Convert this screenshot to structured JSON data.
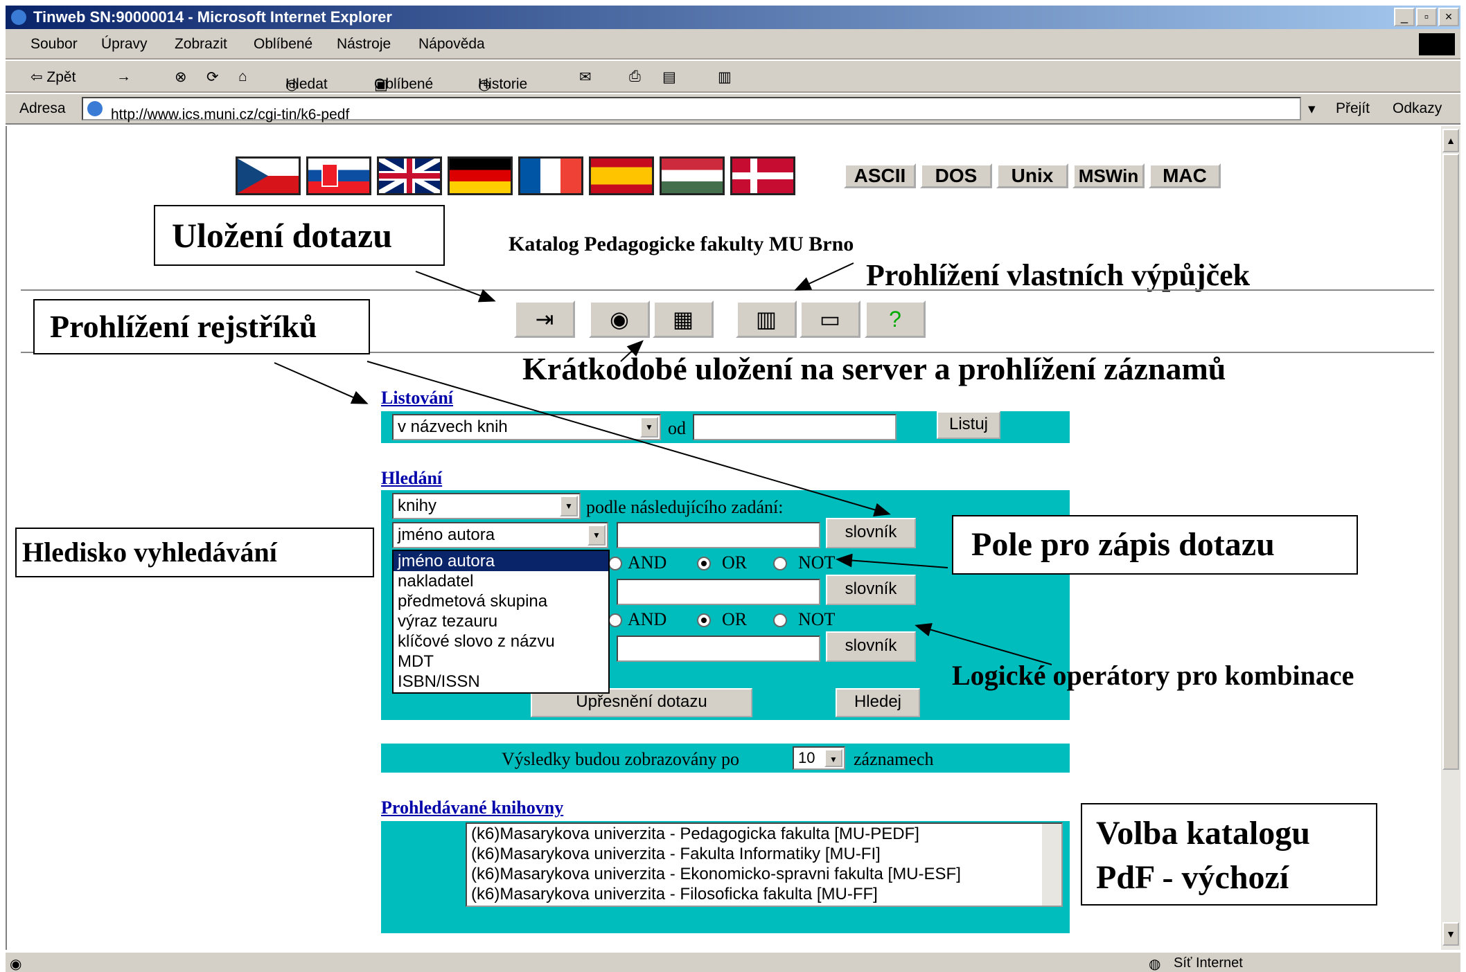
{
  "window": {
    "title": "Tinweb SN:90000014 - Microsoft Internet Explorer",
    "min": "_",
    "max": "▫",
    "close": "×"
  },
  "menu": [
    "Soubor",
    "Úpravy",
    "Zobrazit",
    "Oblíbené",
    "Nástroje",
    "Nápověda"
  ],
  "toolbar": {
    "back": "⇦ Zpět",
    "search": "Hledat",
    "favorites": "Oblíbené",
    "history": "Historie"
  },
  "address": {
    "label": "Adresa",
    "url": "http://www.ics.muni.cz/cgi-tin/k6-pedf",
    "go": "Přejít",
    "links": "Odkazy"
  },
  "encodings": [
    "ASCII",
    "DOS",
    "Unix",
    "MSWin",
    "MAC"
  ],
  "flags": [
    {
      "name": "czech",
      "colors": [
        "#ffffff",
        "#d7141a",
        "#11457e"
      ]
    },
    {
      "name": "slovak",
      "colors": [
        "#ffffff",
        "#0b4ea2",
        "#ee1c25"
      ]
    },
    {
      "name": "british",
      "colors": [
        "#012169",
        "#ffffff",
        "#c8102e"
      ]
    },
    {
      "name": "german",
      "colors": [
        "#000000",
        "#dd0000",
        "#ffce00"
      ]
    },
    {
      "name": "french",
      "colors": [
        "#0055a4",
        "#ffffff",
        "#ef4135"
      ]
    },
    {
      "name": "spanish",
      "colors": [
        "#c60b1e",
        "#ffc400",
        "#c60b1e"
      ]
    },
    {
      "name": "hungarian",
      "colors": [
        "#cd2a3e",
        "#ffffff",
        "#436f4d"
      ]
    },
    {
      "name": "danish",
      "colors": [
        "#c60c30",
        "#ffffff",
        "#c60c30"
      ]
    }
  ],
  "catalog_title": "Katalog Pedagogicke fakulty MU Brno",
  "annotations": {
    "save_query": "Uložení dotazu",
    "own_loans": "Prohlížení vlastních výpůjček",
    "browse_index": "Prohlížení rejstříků",
    "short_save": "Krátkodobé uložení na server a prohlížení záznamů",
    "search_aspect": "Hledisko vyhledávání",
    "query_field": "Pole pro zápis dotazu",
    "logic_ops": "Logické operátory pro kombinace",
    "catalog_choice_1": "Volba katalogu",
    "catalog_choice_2": "PdF - výchozí"
  },
  "help_glyph": "?",
  "listing": {
    "link": "Listování",
    "select": "v názvech knih",
    "od": "od",
    "button": "Listuj"
  },
  "search": {
    "link": "Hledání",
    "type_select": "knihy",
    "spec_label": "podle následujícího zadání:",
    "field1_select": "jméno autora",
    "dict_button": "slovník",
    "dropdown_options": [
      "jméno autora",
      "nakladatel",
      "předmetová skupina",
      "výraz tezauru",
      "klíčové slovo z názvu",
      "MDT",
      "ISBN/ISSN"
    ],
    "ops": [
      "AND",
      "OR",
      "NOT"
    ],
    "refine_button": "Upřesnění dotazu",
    "search_button": "Hledej"
  },
  "results": {
    "prefix": "Výsledky budou zobrazovány po",
    "count": "10",
    "suffix": "záznamech"
  },
  "libraries": {
    "link": "Prohledávané knihovny",
    "items": [
      "(k6)Masarykova univerzita - Pedagogicka fakulta [MU-PEDF]",
      "(k6)Masarykova univerzita - Fakulta Informatiky [MU-FI]",
      "(k6)Masarykova univerzita - Ekonomicko-spravni fakulta [MU-ESF]",
      "(k6)Masarykova univerzita - Filosoficka fakulta [MU-FF]"
    ]
  },
  "status": {
    "zone": "Síť Internet"
  },
  "colors": {
    "panel": "#00bdbd",
    "link": "#0000aa",
    "title_bar": "#0a246a"
  }
}
